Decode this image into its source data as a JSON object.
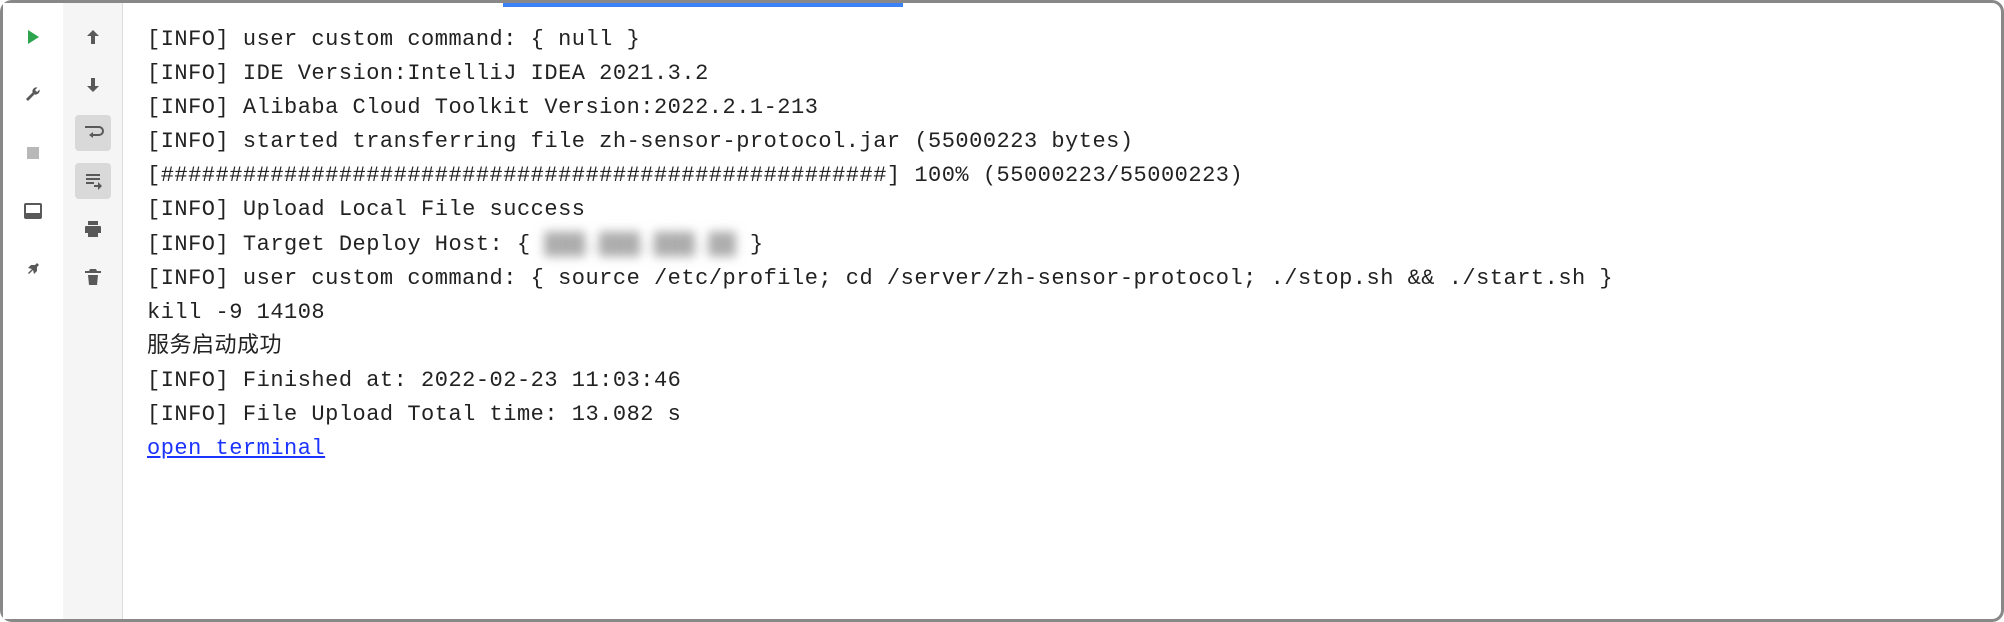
{
  "toolbar_left": {
    "run": "run-icon",
    "wrench": "wrench-icon",
    "stop": "stop-icon",
    "layout": "layout-icon",
    "pin": "pin-icon"
  },
  "toolbar_right": {
    "up": "arrow-up-icon",
    "down": "arrow-down-icon",
    "wrap": "soft-wrap-icon",
    "scroll_end": "scroll-to-end-icon",
    "print": "print-icon",
    "trash": "trash-icon"
  },
  "console": {
    "lines": [
      "[INFO] user custom command: { null }",
      "[INFO] IDE Version:IntelliJ IDEA 2021.3.2",
      "[INFO] Alibaba Cloud Toolkit Version:2022.2.1-213",
      "[INFO] started transferring file zh-sensor-protocol.jar (55000223 bytes)",
      "[#####################################################] 100% (55000223/55000223)",
      "[INFO] Upload Local File success",
      "[INFO] Target Deploy Host: { ",
      " }",
      "[INFO] user custom command: { source /etc/profile; cd /server/zh-sensor-protocol; ./stop.sh && ./start.sh }",
      "kill -9 14108",
      "服务启动成功",
      "[INFO] Finished at: 2022-02-23 11:03:46",
      "[INFO] File Upload Total time: 13.082 s"
    ],
    "masked_host": "███.███.███.██",
    "link_text": "open terminal"
  }
}
